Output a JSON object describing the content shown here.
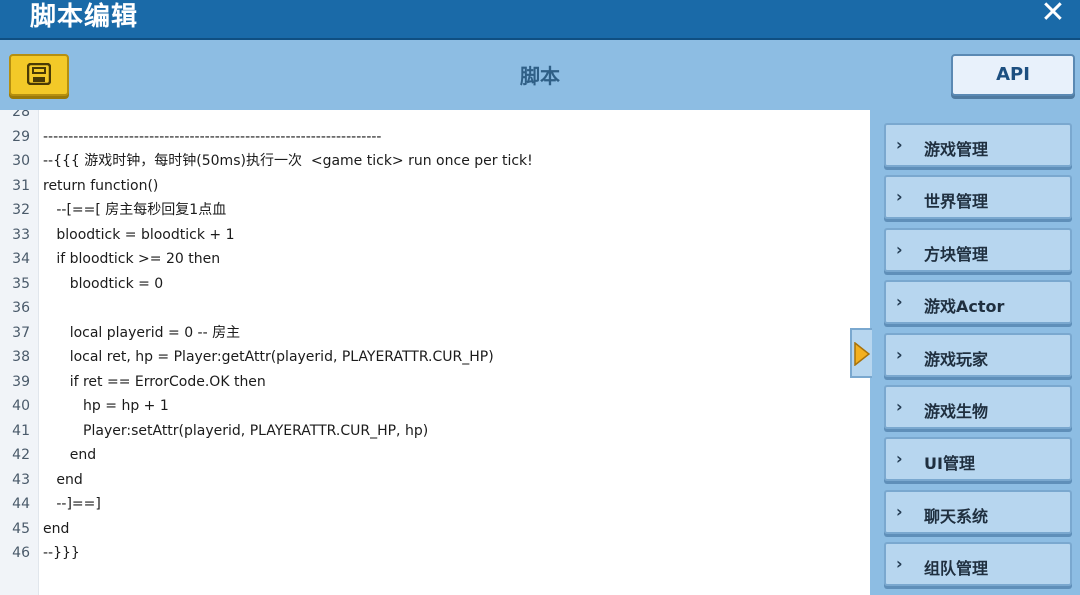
{
  "window": {
    "title": "脚本编辑"
  },
  "toolbar": {
    "title": "脚本",
    "api_label": "API"
  },
  "editor": {
    "lines": [
      {
        "num": "28",
        "text": ""
      },
      {
        "num": "29",
        "text": "-------------------------------------------------------------------"
      },
      {
        "num": "30",
        "text": "--{{{ 游戏时钟，每时钟(50ms)执行一次  <game tick> run once per tick!"
      },
      {
        "num": "31",
        "text": "return function()"
      },
      {
        "num": "32",
        "text": "   --[==[ 房主每秒回复1点血"
      },
      {
        "num": "33",
        "text": "   bloodtick = bloodtick + 1"
      },
      {
        "num": "34",
        "text": "   if bloodtick >= 20 then"
      },
      {
        "num": "35",
        "text": "      bloodtick = 0"
      },
      {
        "num": "36",
        "text": ""
      },
      {
        "num": "37",
        "text": "      local playerid = 0 -- 房主"
      },
      {
        "num": "38",
        "text": "      local ret, hp = Player:getAttr(playerid, PLAYERATTR.CUR_HP)"
      },
      {
        "num": "39",
        "text": "      if ret == ErrorCode.OK then"
      },
      {
        "num": "40",
        "text": "         hp = hp + 1"
      },
      {
        "num": "41",
        "text": "         Player:setAttr(playerid, PLAYERATTR.CUR_HP, hp)"
      },
      {
        "num": "42",
        "text": "      end"
      },
      {
        "num": "43",
        "text": "   end"
      },
      {
        "num": "44",
        "text": "   --]==]"
      },
      {
        "num": "45",
        "text": "end"
      },
      {
        "num": "46",
        "text": "--}}}"
      }
    ]
  },
  "sidebar": {
    "items": [
      {
        "label": "游戏管理"
      },
      {
        "label": "世界管理"
      },
      {
        "label": "方块管理"
      },
      {
        "label": "游戏Actor"
      },
      {
        "label": "游戏玩家"
      },
      {
        "label": "游戏生物"
      },
      {
        "label": "UI管理"
      },
      {
        "label": "聊天系统"
      },
      {
        "label": "组队管理"
      }
    ],
    "selected_index": 4
  },
  "colors": {
    "titlebar": "#1a6aa8",
    "background": "#8dbde3",
    "save_button": "#f3c928",
    "pointer": "#f3b020"
  },
  "icons": {
    "save": "floppy-disk-icon",
    "close": "close-icon",
    "chevron": "chevron-right-icon",
    "pointer": "triangle-right-icon"
  }
}
